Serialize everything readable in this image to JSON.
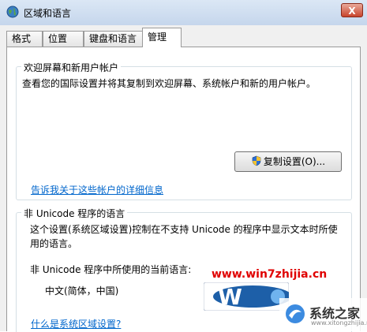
{
  "window": {
    "title": "区域和语言",
    "close_label": "X"
  },
  "tabs": [
    {
      "label": "格式",
      "active": false
    },
    {
      "label": "位置",
      "active": false
    },
    {
      "label": "键盘和语言",
      "active": false
    },
    {
      "label": "管理",
      "active": true
    }
  ],
  "welcome_group": {
    "title": "欢迎屏幕和新用户帐户",
    "description": "查看您的国际设置并将其复制到欢迎屏幕、系统帐户和新的用户帐户。",
    "copy_button": "复制设置(O)...",
    "link": "告诉我关于这些帐户的详细信息"
  },
  "unicode_group": {
    "title": "非 Unicode 程序的语言",
    "description": "这个设置(系统区域设置)控制在不支持 Unicode 的程序中显示文本时所使用的语言。",
    "current_label": "非 Unicode 程序中所使用的当前语言:",
    "current_value": "中文(简体，中国)",
    "link": "什么是系统区域设置?"
  },
  "watermark": {
    "url": "www.win7zhijia.cn",
    "logo_text": "W",
    "brand": "系统之家",
    "brand_url": "www.xitongzhijia.net"
  },
  "colors": {
    "link": "#0066cc",
    "watermark_red": "#e00000"
  }
}
